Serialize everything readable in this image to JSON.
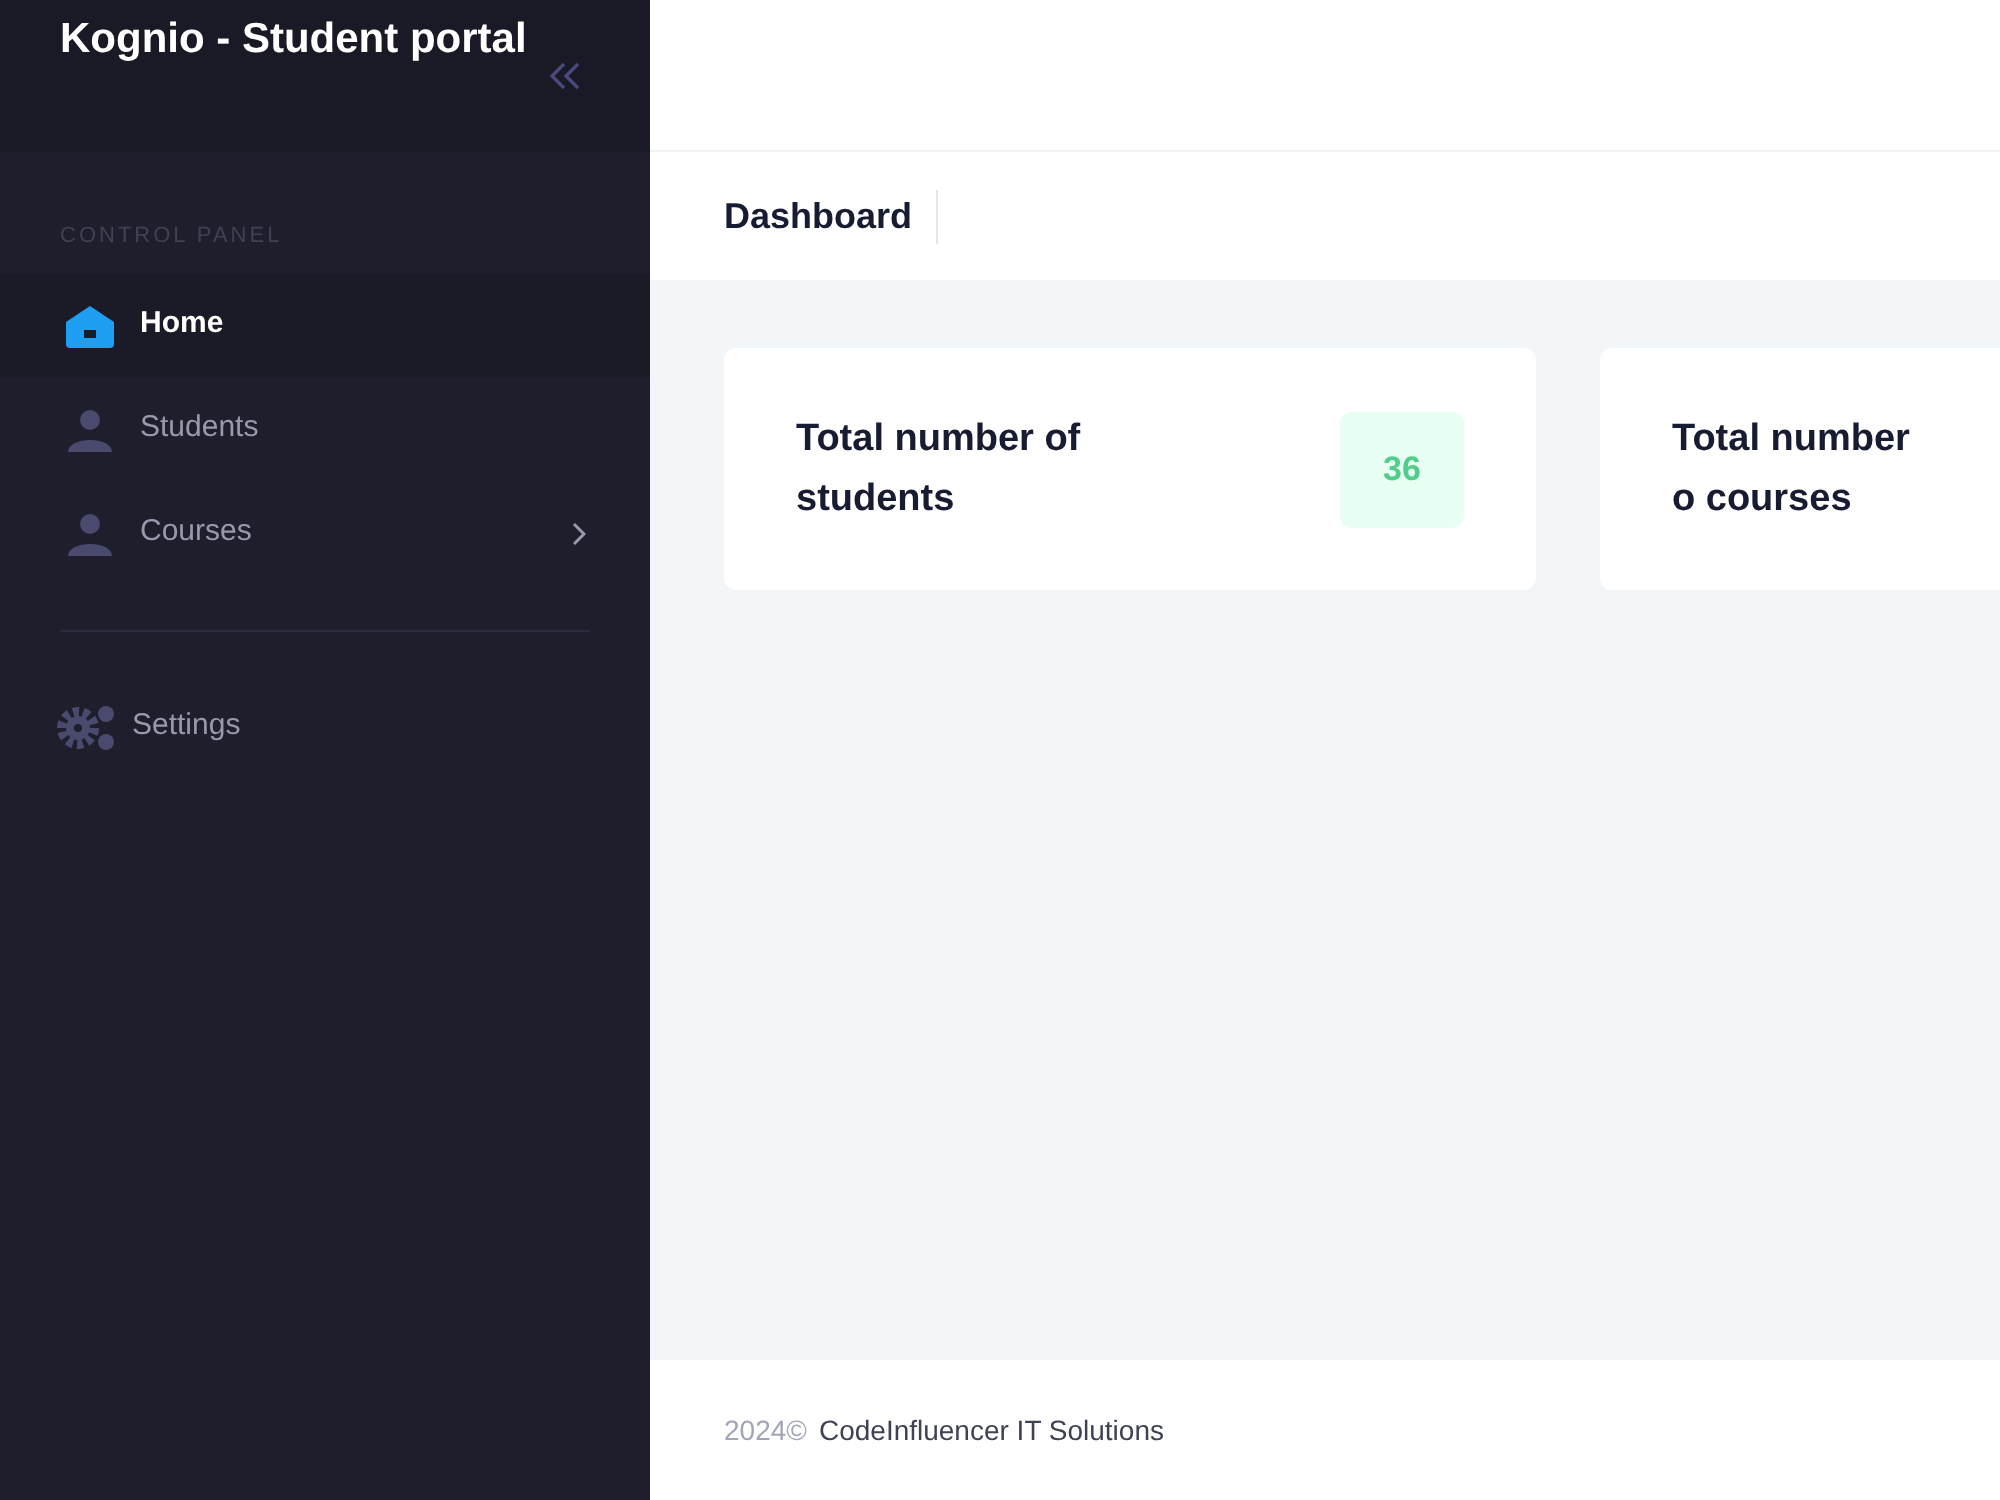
{
  "sidebar": {
    "brand": "Kognio - Student portal",
    "section_label": "CONTROL PANEL",
    "items": [
      {
        "label": "Home",
        "kind": "home",
        "selected": true,
        "has_submenu": false
      },
      {
        "label": "Students",
        "kind": "user",
        "selected": false,
        "has_submenu": false
      },
      {
        "label": "Courses",
        "kind": "user",
        "selected": false,
        "has_submenu": true
      }
    ],
    "bottom_items": [
      {
        "label": "Settings",
        "kind": "gears",
        "selected": false
      }
    ]
  },
  "toolbar": {
    "title": "Dashboard"
  },
  "cards": [
    {
      "title": "Total number of students",
      "count": "36"
    },
    {
      "title": "Total number o courses"
    }
  ],
  "footer": {
    "year": "2024©",
    "company": "CodeInfluencer IT Solutions"
  }
}
